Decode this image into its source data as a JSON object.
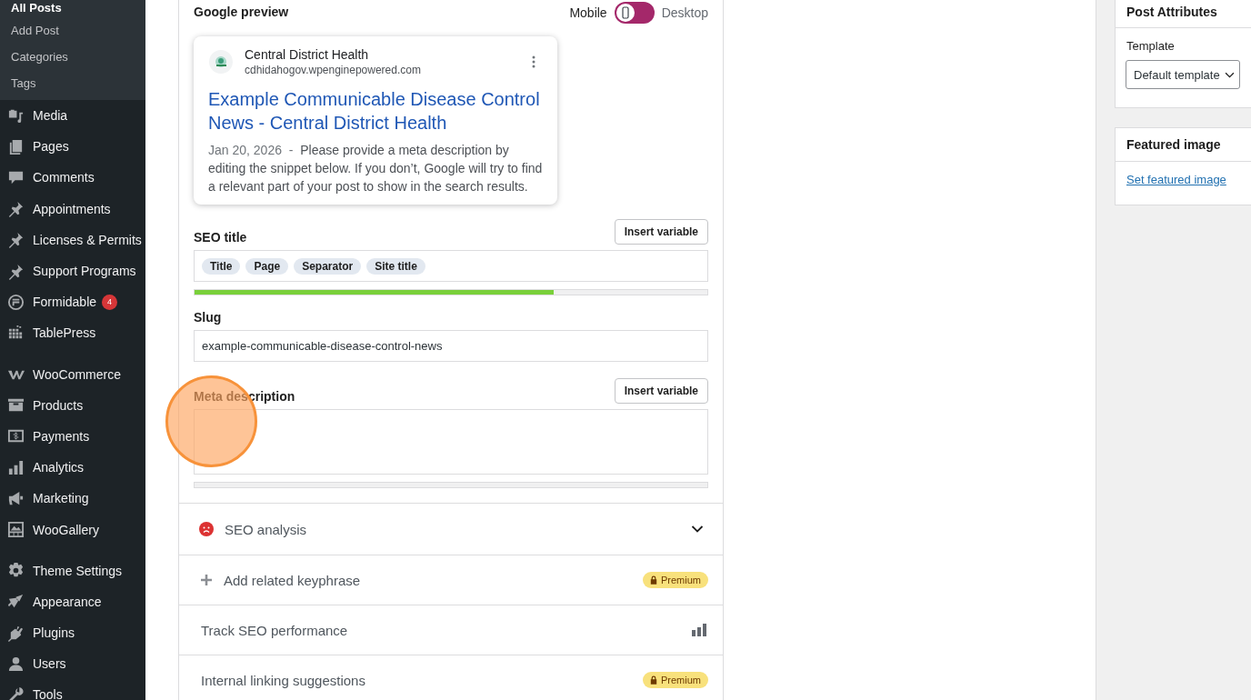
{
  "sidebar": {
    "submenu": [
      {
        "label": "All Posts",
        "selected": true
      },
      {
        "label": "Add Post",
        "selected": false
      },
      {
        "label": "Categories",
        "selected": false
      },
      {
        "label": "Tags",
        "selected": false
      }
    ],
    "menu_groups": [
      [
        {
          "label": "Media"
        },
        {
          "label": "Pages"
        },
        {
          "label": "Comments"
        },
        {
          "label": "Appointments"
        },
        {
          "label": "Licenses & Permits"
        },
        {
          "label": "Support Programs"
        },
        {
          "label": "Formidable",
          "badge": "4"
        },
        {
          "label": "TablePress"
        }
      ],
      [
        {
          "label": "WooCommerce"
        },
        {
          "label": "Products"
        },
        {
          "label": "Payments"
        },
        {
          "label": "Analytics"
        },
        {
          "label": "Marketing"
        },
        {
          "label": "WooGallery"
        }
      ],
      [
        {
          "label": "Theme Settings"
        },
        {
          "label": "Appearance"
        },
        {
          "label": "Plugins"
        },
        {
          "label": "Users"
        },
        {
          "label": "Tools"
        }
      ]
    ]
  },
  "google_preview": {
    "heading": "Google preview",
    "modes": [
      {
        "label": "Mobile",
        "selected": true
      },
      {
        "label": "Desktop",
        "selected": false
      }
    ],
    "result": {
      "site_name": "Central District Health",
      "url": "cdhidahogov.wpenginepowered.com",
      "title": "Example Communicable Disease Control News - Central District Health",
      "date": "Jan 20, 2026",
      "separator": "-",
      "description": "Please provide a meta description by editing the snippet below. If you don’t, Google will try to find a relevant part of your post to show in the search results."
    }
  },
  "seo_title": {
    "label": "SEO title",
    "button": "Insert variable",
    "tags": [
      "Title",
      "Page",
      "Separator",
      "Site title"
    ],
    "level": 0.7
  },
  "slug": {
    "label": "Slug",
    "value": "example-communicable-disease-control-news"
  },
  "meta_description": {
    "label": "Meta description",
    "button": "Insert variable",
    "level": 0
  },
  "sections": [
    {
      "kind": "analysis",
      "label": "SEO analysis",
      "expanded": false
    },
    {
      "kind": "keyphrase",
      "label": "Add related keyphrase",
      "badge": "Premium"
    },
    {
      "kind": "tracking",
      "label": "Track SEO performance"
    },
    {
      "kind": "linking",
      "label": "Internal linking suggestions",
      "badge": "Premium"
    }
  ],
  "post_attributes": {
    "title": "Post Attributes",
    "template_label": "Template",
    "template_value": "Default template"
  },
  "featured_image": {
    "title": "Featured image",
    "link": "Set featured image"
  }
}
